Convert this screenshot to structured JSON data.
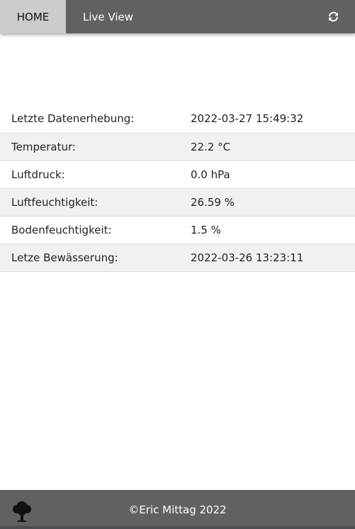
{
  "nav": {
    "home_label": "HOME",
    "liveview_label": "Live View",
    "refresh_icon": "refresh-icon"
  },
  "rows": [
    {
      "label": "Letzte Datenerhebung:",
      "value": "2022-03-27 15:49:32"
    },
    {
      "label": "Temperatur:",
      "value": "22.2 °C"
    },
    {
      "label": "Luftdruck:",
      "value": "0.0 hPa"
    },
    {
      "label": "Luftfeuchtigkeit:",
      "value": "26.59 %"
    },
    {
      "label": "Bodenfeuchtigkeit:",
      "value": "1.5 %"
    },
    {
      "label": "Letze Bewässerung:",
      "value": "2022-03-26 13:23:11"
    }
  ],
  "footer": {
    "copyright": "©Eric Mittag 2022",
    "logo_icon": "tree-icon"
  },
  "colors": {
    "navbar": "#616161",
    "active_tab": "#cccccc",
    "row_alt": "#f1f1f1",
    "footer": "#616161"
  }
}
